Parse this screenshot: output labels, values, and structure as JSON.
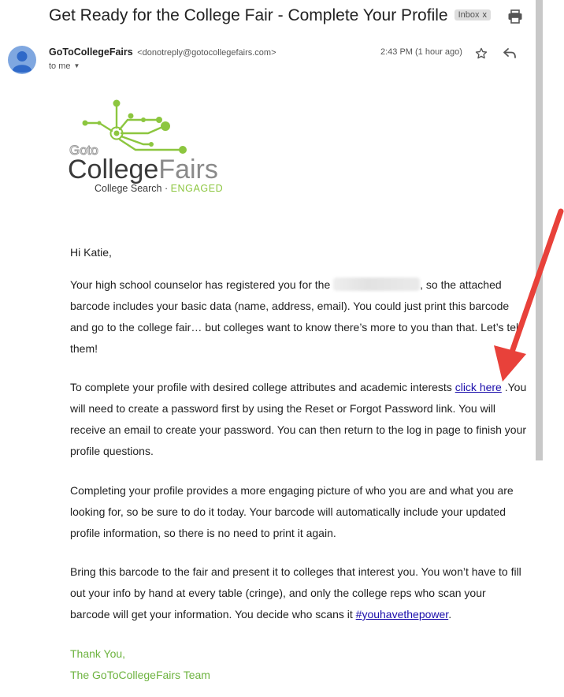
{
  "email": {
    "subject": "Get Ready for the College Fair - Complete Your Profile",
    "label_badge": "Inbox",
    "label_badge_close": "x",
    "sender_name": "GoToCollegeFairs",
    "sender_email": "<donotreply@gotocollegefairs.com>",
    "recipient": "to me",
    "timestamp": "2:43 PM (1 hour ago)",
    "icons": {
      "print": "print-icon",
      "star": "star-icon",
      "reply": "reply-icon",
      "avatar": "person-avatar",
      "caret": "chevron-down-icon"
    }
  },
  "logo": {
    "goto": "Goto",
    "college": "College",
    "fairs": "Fairs",
    "tagline_prefix": "College Search · ",
    "tagline_accent": "ENGAGED",
    "colors": {
      "green": "#8cc63f",
      "dark": "#3a3a3a",
      "gray": "#8a8a8a"
    }
  },
  "body": {
    "greeting": "Hi Katie,",
    "p1_before": "Your high school counselor has registered you for the ",
    "p1_after": ", so the attached barcode includes your basic data (name, address, email). You could just print this barcode and go to the college fair… but colleges want to know there’s more to you than that. Let’s tell them!",
    "p2_before": "To complete your profile with desired college attributes and academic interests ",
    "p2_link": "click here",
    "p2_after": " .You will need to create a password first by using the Reset or Forgot Password link. You will receive an email to create your password. You can then return to the log in page to finish your profile questions.",
    "p3": "Completing your profile provides a more engaging picture of who you are and what you are looking for, so be sure to do it today. Your barcode will automatically include your updated profile information, so there is no need to print it again.",
    "p4_before": "Bring this barcode to the fair and present it to colleges that interest you. You won’t have to fill out your info by hand at every table (cringe), and only the college reps who scan your barcode will get your information. You decide who scans it ",
    "p4_link": "#youhavethepower",
    "p4_after": ".",
    "signoff1": "Thank You,",
    "signoff2": "The GoToCollegeFairs Team"
  },
  "colors": {
    "link": "#1a0dab",
    "signoff": "#6db33f",
    "annotation_arrow": "#e8413a"
  }
}
